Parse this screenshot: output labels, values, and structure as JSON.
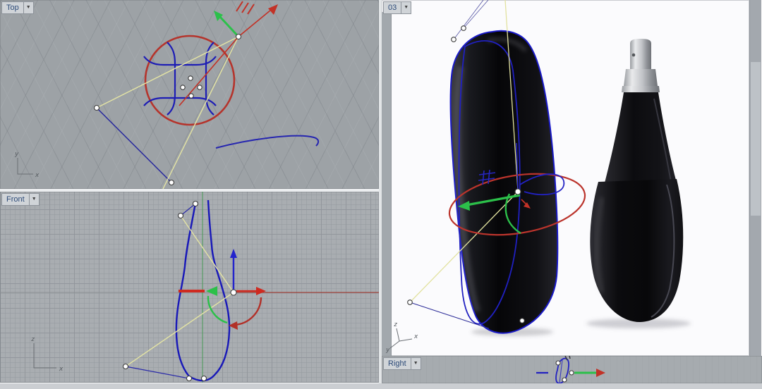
{
  "icons": {
    "dropdown_arrow": "▼"
  },
  "colors": {
    "curve_blue": "#1d1db5",
    "curve_red": "#c23227",
    "curve_yellow": "#e4e4a4",
    "curve_green": "#2cc04a",
    "grid_gray_top": "#9da2a6",
    "grid_gray_front": "#a9adb1",
    "render_background": "#fbfbfd",
    "label_text": "#2c4a78"
  },
  "viewports": {
    "top": {
      "label": "Top",
      "axes": {
        "vertical": "y",
        "horizontal": "x"
      }
    },
    "front": {
      "label": "Front",
      "axes": {
        "vertical": "z",
        "horizontal": "x"
      }
    },
    "perspective": {
      "label": "03",
      "axes": {
        "up": "z",
        "right": "x",
        "depth": "y"
      }
    },
    "right": {
      "label": "Right"
    }
  }
}
